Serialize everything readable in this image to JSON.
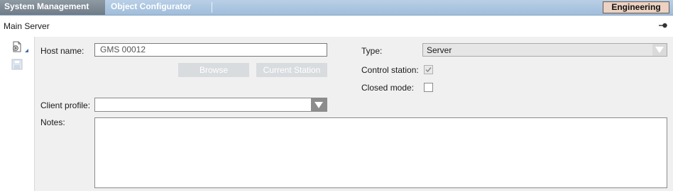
{
  "tabs": [
    {
      "label": "System Management",
      "active": true
    },
    {
      "label": "Object Configurator",
      "active": false
    }
  ],
  "mode_button": {
    "label": "Engineering"
  },
  "page": {
    "title": "Main Server"
  },
  "form": {
    "host_name": {
      "label": "Host name:",
      "value": "GMS 00012"
    },
    "browse_button": {
      "label": "Browse",
      "enabled": false
    },
    "current_station_button": {
      "label": "Current Station",
      "enabled": false
    },
    "client_profile": {
      "label": "Client profile:",
      "value": ""
    },
    "notes": {
      "label": "Notes:",
      "value": ""
    },
    "type": {
      "label": "Type:",
      "value": "Server",
      "enabled": false
    },
    "control_station": {
      "label": "Control station:",
      "checked": true,
      "enabled": false
    },
    "closed_mode": {
      "label": "Closed mode:",
      "checked": false
    }
  },
  "icons": [
    "new-document-icon",
    "save-icon",
    "pin-icon",
    "chevron-down-icon"
  ],
  "colors": {
    "tab_bar": "#9fbddb",
    "active_tab": "#7d8893",
    "engineering_button": "#ecd2c2",
    "panel": "#f0f0f0"
  }
}
